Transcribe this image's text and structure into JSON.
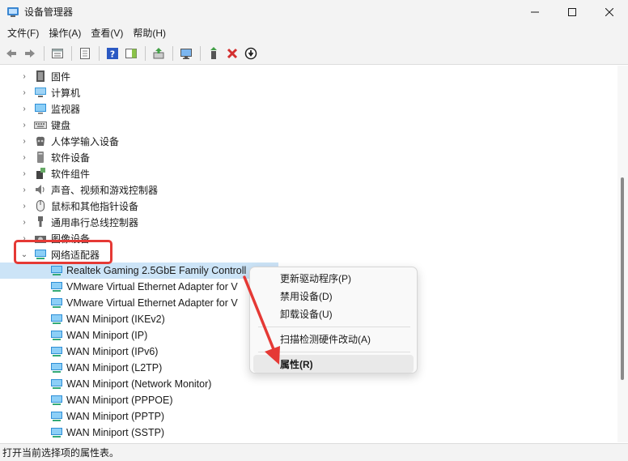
{
  "window": {
    "title": "设备管理器",
    "controls": {
      "minimize": "—",
      "maximize": "☐",
      "close": "✕"
    }
  },
  "menubar": {
    "items": [
      {
        "label": "文件(F)"
      },
      {
        "label": "操作(A)"
      },
      {
        "label": "查看(V)"
      },
      {
        "label": "帮助(H)"
      }
    ]
  },
  "toolbar": {
    "icons": [
      "back-arrow-icon",
      "forward-arrow-icon",
      "device-view-icon",
      "properties-sheet-icon",
      "help-icon",
      "action-pane-icon",
      "update-driver-icon",
      "scan-hardware-icon",
      "enable-device-icon",
      "uninstall-device-icon",
      "disable-device-icon"
    ]
  },
  "tree": {
    "categories": [
      {
        "label": "固件",
        "icon": "firmware-icon"
      },
      {
        "label": "计算机",
        "icon": "computer-icon"
      },
      {
        "label": "监视器",
        "icon": "monitor-icon"
      },
      {
        "label": "键盘",
        "icon": "keyboard-icon"
      },
      {
        "label": "人体学输入设备",
        "icon": "hid-icon"
      },
      {
        "label": "软件设备",
        "icon": "software-device-icon"
      },
      {
        "label": "软件组件",
        "icon": "software-component-icon"
      },
      {
        "label": "声音、视频和游戏控制器",
        "icon": "speaker-icon"
      },
      {
        "label": "鼠标和其他指针设备",
        "icon": "mouse-icon"
      },
      {
        "label": "通用串行总线控制器",
        "icon": "usb-icon"
      },
      {
        "label": "图像设备",
        "icon": "camera-icon"
      },
      {
        "label": "网络适配器",
        "icon": "network-adapter-icon"
      }
    ],
    "network_children": [
      {
        "label": "Realtek Gaming 2.5GbE Family Controll"
      },
      {
        "label": "VMware Virtual Ethernet Adapter for V"
      },
      {
        "label": "VMware Virtual Ethernet Adapter for V"
      },
      {
        "label": "WAN Miniport (IKEv2)"
      },
      {
        "label": "WAN Miniport (IP)"
      },
      {
        "label": "WAN Miniport (IPv6)"
      },
      {
        "label": "WAN Miniport (L2TP)"
      },
      {
        "label": "WAN Miniport (Network Monitor)"
      },
      {
        "label": "WAN Miniport (PPPOE)"
      },
      {
        "label": "WAN Miniport (PPTP)"
      },
      {
        "label": "WAN Miniport (SSTP)"
      }
    ]
  },
  "context_menu": {
    "update_driver": "更新驱动程序(P)",
    "disable_device": "禁用设备(D)",
    "uninstall_device": "卸载设备(U)",
    "scan_hardware": "扫描检测硬件改动(A)",
    "properties": "属性(R)"
  },
  "statusbar": {
    "text": "打开当前选择项的属性表。"
  },
  "colors": {
    "highlight_box": "#e53935",
    "selection": "#cce4f7",
    "arrow": "#e53935"
  }
}
